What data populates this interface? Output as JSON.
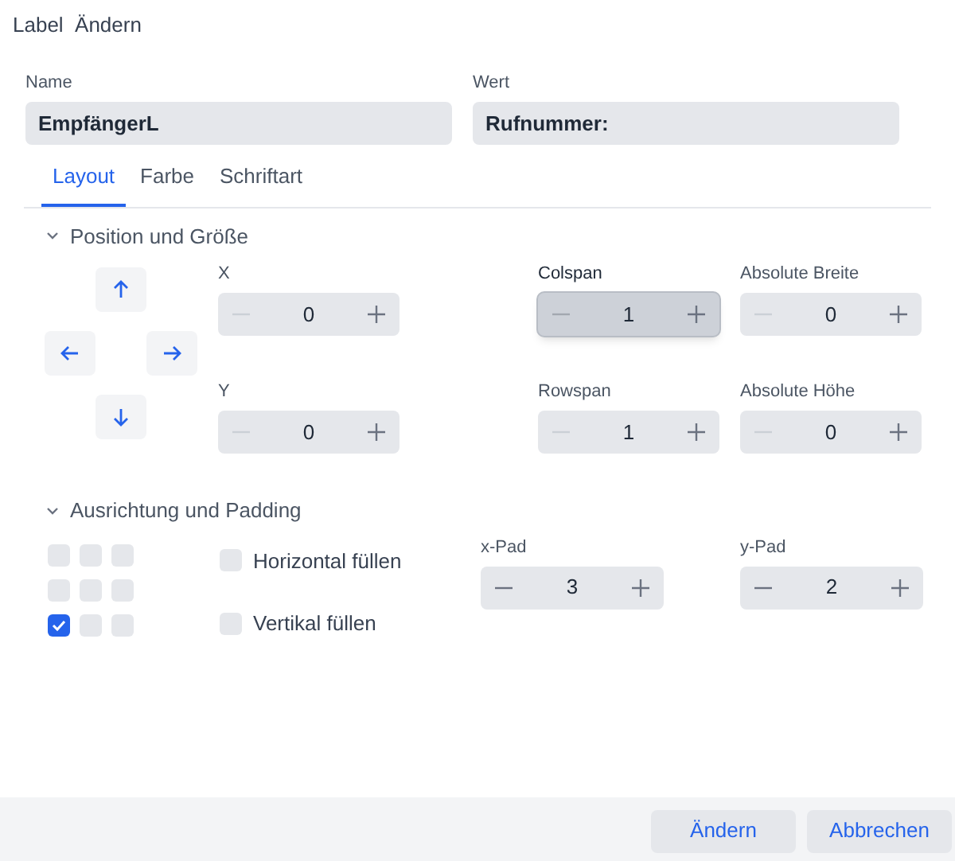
{
  "window": {
    "title": "Label  Ändern"
  },
  "fields": [
    {
      "label": "Name",
      "value": "EmpfängerL"
    },
    {
      "label": "Wert",
      "value": "Rufnummer:"
    }
  ],
  "tabs": [
    {
      "label": "Layout",
      "selected": true
    },
    {
      "label": "Farbe",
      "selected": false
    },
    {
      "label": "Schriftart",
      "selected": false
    }
  ],
  "position_section": {
    "title": "Position und Größe",
    "expanded": true,
    "steppers": [
      {
        "label": "X",
        "value": "0",
        "minus_disabled": true,
        "hovered": false
      },
      {
        "label": "Colspan",
        "value": "1",
        "minus_disabled": true,
        "hovered": true
      },
      {
        "label": "Absolute Breite",
        "value": "0",
        "minus_disabled": true,
        "hovered": false
      },
      {
        "label": "Y",
        "value": "0",
        "minus_disabled": true,
        "hovered": false
      },
      {
        "label": "Rowspan",
        "value": "1",
        "minus_disabled": true,
        "hovered": false
      },
      {
        "label": "Absolute Höhe",
        "value": "0",
        "minus_disabled": true,
        "hovered": false
      }
    ]
  },
  "alignment_section": {
    "title": "Ausrichtung und Padding",
    "expanded": true,
    "anchors": [
      {
        "selected": false
      },
      {
        "selected": false
      },
      {
        "selected": false
      },
      {
        "selected": false
      },
      {
        "selected": false
      },
      {
        "selected": false
      },
      {
        "selected": true
      },
      {
        "selected": false
      },
      {
        "selected": false
      }
    ],
    "fill_options": [
      {
        "label": "Horizontal füllen",
        "checked": false
      },
      {
        "label": "Vertikal füllen",
        "checked": false
      }
    ],
    "steppers": [
      {
        "label": "x-Pad",
        "value": "3",
        "minus_disabled": false,
        "hovered": false
      },
      {
        "label": "y-Pad",
        "value": "2",
        "minus_disabled": false,
        "hovered": false
      }
    ]
  },
  "buttons": [
    {
      "label": "Ändern"
    },
    {
      "label": "Abbrechen"
    }
  ]
}
